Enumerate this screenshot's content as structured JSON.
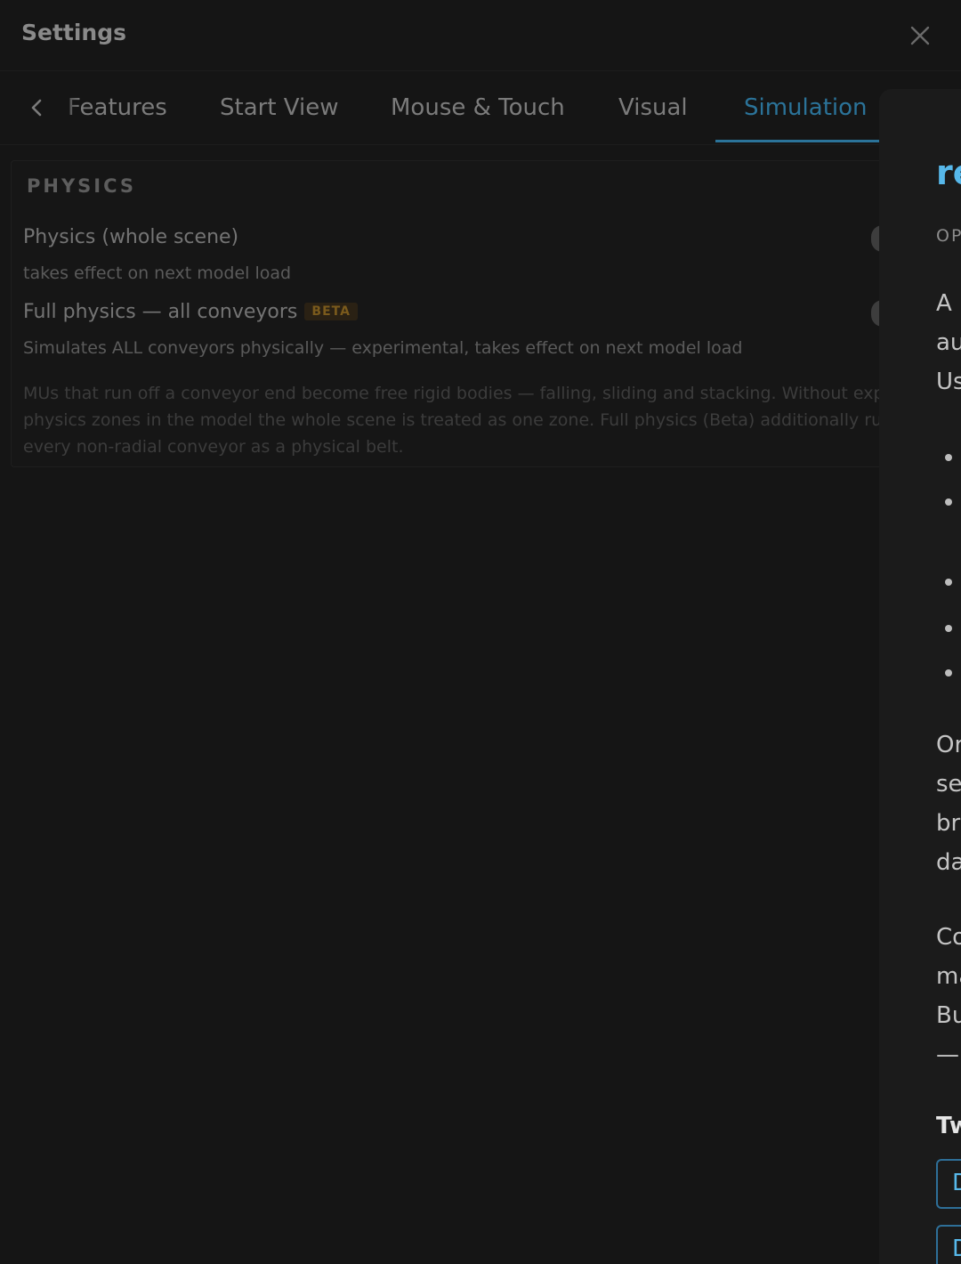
{
  "header": {
    "title": "Settings"
  },
  "tabs": {
    "items": [
      {
        "label": "Features"
      },
      {
        "label": "Start View"
      },
      {
        "label": "Mouse & Touch"
      },
      {
        "label": "Visual"
      },
      {
        "label": "Simulation"
      }
    ],
    "active": "Simulation"
  },
  "physics": {
    "section_title": "PHYSICS",
    "whole_scene": {
      "label": "Physics (whole scene)",
      "hint": "takes effect on next model load"
    },
    "full_physics": {
      "label": "Full physics — all conveyors",
      "badge": "BETA",
      "hint": "Simulates ALL conveyors physically — experimental, takes effect on next model load"
    },
    "description_lines": [
      "MUs that run off a conveyor end become free rigid bodies — falling, sliding and stacking. Without expl",
      "physics zones in the model the whole scene is treated as one zone. Full physics (Beta) additionally run",
      "every non-radial conveyor as a physical belt."
    ]
  },
  "drawer": {
    "title": "re",
    "meta": "OP",
    "para1": [
      "A",
      "au",
      "Us"
    ],
    "para2": [
      "Or",
      "se",
      "bro",
      "da"
    ],
    "para3": [
      "Co",
      "ma",
      "Bu",
      "—"
    ],
    "heading": "Tw",
    "buttons": [
      "D",
      "D"
    ]
  },
  "colors": {
    "accent": "#2b7399",
    "drawer_accent": "#57b8ea",
    "beta": "#7a5a1c"
  }
}
